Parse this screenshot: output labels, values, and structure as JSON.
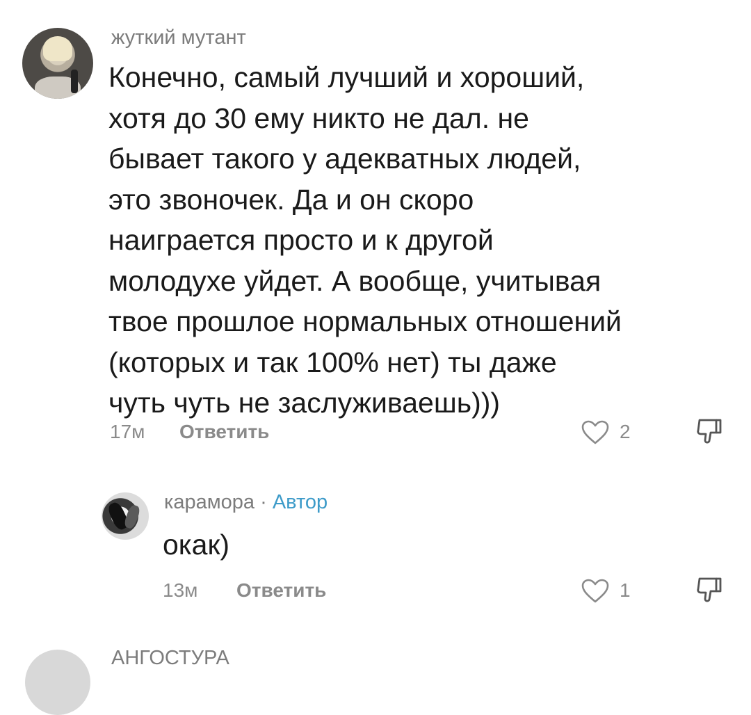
{
  "comments": [
    {
      "author": "жуткий мутант",
      "text_lines": [
        "Конечно, самый лучший и хороший,",
        "хотя до 30 ему никто не дал. не",
        "бывает такого у адекватных людей,",
        "это звоночек. Да и он скоро",
        "наиграется просто и к другой",
        "молодухе уйдет. А вообще, учитывая",
        "твое прошлое нормальных отношений",
        "(которых и так 100% нет) ты даже",
        "чуть чуть не заслуживаешь)))"
      ],
      "time": "17м",
      "reply_label": "Ответить",
      "likes": "2"
    },
    {
      "author": "карамора",
      "separator": "·",
      "badge": "Автор",
      "text_lines": [
        "окак)"
      ],
      "time": "13м",
      "reply_label": "Ответить",
      "likes": "1"
    },
    {
      "author": "АНГОСТУРА"
    }
  ],
  "colors": {
    "author": "#7c7c7c",
    "badge": "#3d9bc9",
    "text": "#1a1a1a",
    "meta": "#8a8a8a"
  },
  "icons": {
    "like": "heart-outline-icon",
    "dislike": "thumbs-down-outline-icon"
  }
}
